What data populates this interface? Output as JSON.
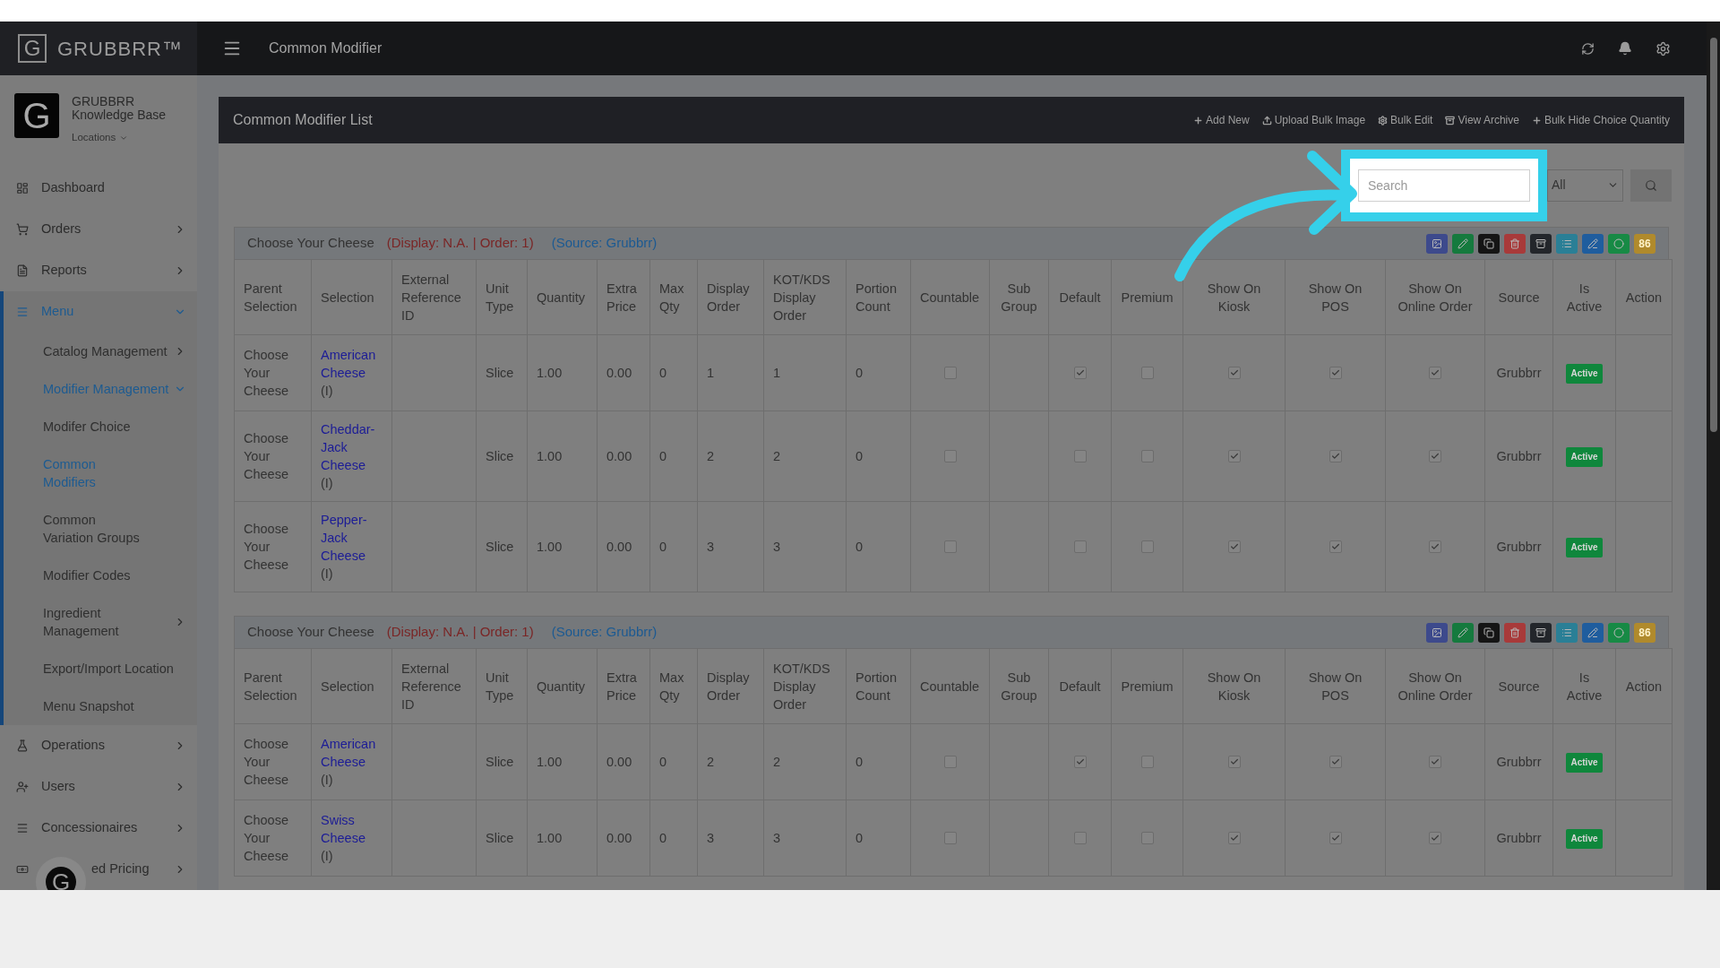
{
  "header": {
    "logo_mark": "G",
    "logo_text": "GRUBBRR™",
    "page_title": "Common Modifier"
  },
  "account": {
    "avatar_mark": "G",
    "name_line_1": "GRUBBRR",
    "name_line_2": "Knowledge Base",
    "locations": "Locations"
  },
  "sidebar": {
    "items": [
      {
        "label": "Dashboard",
        "selected": false
      },
      {
        "label": "Orders",
        "selected": false,
        "expanded": false
      },
      {
        "label": "Reports",
        "selected": false,
        "expanded": false
      },
      {
        "label": "Menu",
        "selected": true,
        "expanded": true,
        "children": [
          {
            "label": "Catalog Management",
            "selected": false,
            "expanded": false
          },
          {
            "label": "Modifier Management",
            "selected": true,
            "expanded": true,
            "children": [
              {
                "label": "Modifer Choice",
                "selected": false
              },
              {
                "label": "Common Modifiers",
                "selected": true
              },
              {
                "label": "Common Variation Groups",
                "selected": false
              },
              {
                "label": "Modifier Codes",
                "selected": false
              }
            ]
          },
          {
            "label": "Ingredient Management",
            "selected": false,
            "expanded": false
          },
          {
            "label": "Export/Import Location",
            "selected": false
          },
          {
            "label": "Menu Snapshot",
            "selected": false
          }
        ]
      },
      {
        "label": "Operations",
        "selected": false,
        "expanded": false
      },
      {
        "label": "Users",
        "selected": false,
        "expanded": false
      },
      {
        "label": "Concessionaires",
        "selected": false,
        "expanded": false
      },
      {
        "label": "ed Pricing",
        "selected": false,
        "expanded": false
      }
    ]
  },
  "chat_bubble": {
    "mark": "G"
  },
  "panel": {
    "title": "Common Modifier List",
    "actions": [
      "Add New",
      "Upload Bulk Image",
      "Bulk Edit",
      "View Archive",
      "Bulk Hide Choice Quantity"
    ],
    "search": {
      "placeholder": "Search"
    },
    "filter": {
      "value": "All"
    },
    "groups": [
      {
        "title": "Choose Your Cheese",
        "display_info": "(Display: N.A. | Order: 1)",
        "source_info": "(Source: Grubbrr)",
        "buttons": [
          {
            "color": "#3d4a8c"
          },
          {
            "color": "#157a3e"
          },
          {
            "color": "#151515"
          },
          {
            "color": "#a83a3a"
          },
          {
            "color": "#23262b"
          },
          {
            "color": "#2a7f96"
          },
          {
            "color": "#1f5d9e"
          },
          {
            "color": "#178a45"
          },
          {
            "color": "#b08a2c",
            "label": "86"
          }
        ],
        "columns": [
          "Parent Selection",
          "Selection",
          "External Reference ID",
          "Unit Type",
          "Quantity",
          "Extra Price",
          "Max Qty",
          "Display Order",
          "KOT/KDS Display Order",
          "Portion Count",
          "Countable",
          "Sub Group",
          "Default",
          "Premium",
          "Show On Kiosk",
          "Show On POS",
          "Show On Online Order",
          "Source",
          "Is Active",
          "Action"
        ],
        "rows": [
          {
            "parent": "Choose Your Cheese",
            "selection": "American Cheese",
            "selection_note": "(I)",
            "unit_type": "Slice",
            "quantity": "1.00",
            "extra_price": "0.00",
            "max_qty": "0",
            "display_order": "1",
            "kds_display_order": "1",
            "portion_count": "0",
            "countable": false,
            "default": true,
            "premium": false,
            "show_on_kiosk": true,
            "show_on_pos": true,
            "show_on_online_order": true,
            "source": "Grubbrr",
            "status": "Active"
          },
          {
            "parent": "Choose Your Cheese",
            "selection": "Cheddar-Jack Cheese",
            "selection_note": "(I)",
            "unit_type": "Slice",
            "quantity": "1.00",
            "extra_price": "0.00",
            "max_qty": "0",
            "display_order": "2",
            "kds_display_order": "2",
            "portion_count": "0",
            "countable": false,
            "default": false,
            "premium": false,
            "show_on_kiosk": true,
            "show_on_pos": true,
            "show_on_online_order": true,
            "source": "Grubbrr",
            "status": "Active"
          },
          {
            "parent": "Choose Your Cheese",
            "selection": "Pepper-Jack Cheese",
            "selection_note": "(I)",
            "unit_type": "Slice",
            "quantity": "1.00",
            "extra_price": "0.00",
            "max_qty": "0",
            "display_order": "3",
            "kds_display_order": "3",
            "portion_count": "0",
            "countable": false,
            "default": false,
            "premium": false,
            "show_on_kiosk": true,
            "show_on_pos": true,
            "show_on_online_order": true,
            "source": "Grubbrr",
            "status": "Active"
          }
        ]
      },
      {
        "title": "Choose Your Cheese",
        "display_info": "(Display: N.A. | Order: 1)",
        "source_info": "(Source: Grubbrr)",
        "buttons": [
          {
            "color": "#3d4a8c"
          },
          {
            "color": "#157a3e"
          },
          {
            "color": "#151515"
          },
          {
            "color": "#a83a3a"
          },
          {
            "color": "#23262b"
          },
          {
            "color": "#2a7f96"
          },
          {
            "color": "#1f5d9e"
          },
          {
            "color": "#178a45"
          },
          {
            "color": "#b08a2c",
            "label": "86"
          }
        ],
        "columns": [
          "Parent Selection",
          "Selection",
          "External Reference ID",
          "Unit Type",
          "Quantity",
          "Extra Price",
          "Max Qty",
          "Display Order",
          "KOT/KDS Display Order",
          "Portion Count",
          "Countable",
          "Sub Group",
          "Default",
          "Premium",
          "Show On Kiosk",
          "Show On POS",
          "Show On Online Order",
          "Source",
          "Is Active",
          "Action"
        ],
        "rows": [
          {
            "parent": "Choose Your Cheese",
            "selection": "American Cheese",
            "selection_note": "(I)",
            "unit_type": "Slice",
            "quantity": "1.00",
            "extra_price": "0.00",
            "max_qty": "0",
            "display_order": "2",
            "kds_display_order": "2",
            "portion_count": "0",
            "countable": false,
            "default": true,
            "premium": false,
            "show_on_kiosk": true,
            "show_on_pos": true,
            "show_on_online_order": true,
            "source": "Grubbrr",
            "status": "Active"
          },
          {
            "parent": "Choose Your Cheese",
            "selection": "Swiss Cheese",
            "selection_note": "(I)",
            "unit_type": "Slice",
            "quantity": "1.00",
            "extra_price": "0.00",
            "max_qty": "0",
            "display_order": "3",
            "kds_display_order": "3",
            "portion_count": "0",
            "countable": false,
            "default": false,
            "premium": false,
            "show_on_kiosk": true,
            "show_on_pos": true,
            "show_on_online_order": true,
            "source": "Grubbrr",
            "status": "Active"
          }
        ]
      }
    ]
  }
}
